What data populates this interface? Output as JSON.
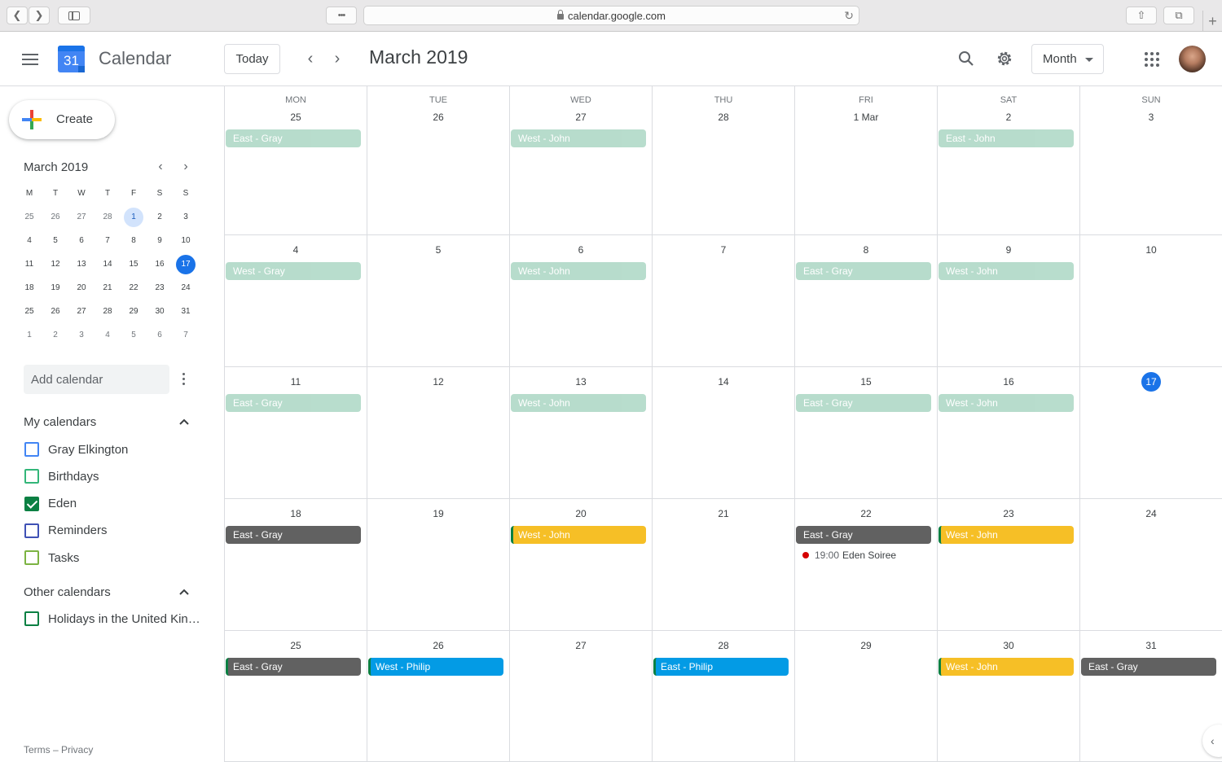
{
  "browser": {
    "url": "calendar.google.com",
    "more_label": "•••"
  },
  "header": {
    "app_title": "Calendar",
    "logo_day": "31",
    "today_label": "Today",
    "period": "March 2019",
    "view_label": "Month"
  },
  "sidebar": {
    "create_label": "Create",
    "mini_month": "March 2019",
    "weekday_heads": [
      "M",
      "T",
      "W",
      "T",
      "F",
      "S",
      "S"
    ],
    "weeks": [
      [
        "25",
        "26",
        "27",
        "28",
        "1",
        "2",
        "3"
      ],
      [
        "4",
        "5",
        "6",
        "7",
        "8",
        "9",
        "10"
      ],
      [
        "11",
        "12",
        "13",
        "14",
        "15",
        "16",
        "17"
      ],
      [
        "18",
        "19",
        "20",
        "21",
        "22",
        "23",
        "24"
      ],
      [
        "25",
        "26",
        "27",
        "28",
        "29",
        "30",
        "31"
      ],
      [
        "1",
        "2",
        "3",
        "4",
        "5",
        "6",
        "7"
      ]
    ],
    "add_calendar_placeholder": "Add calendar",
    "my_calendars_title": "My calendars",
    "my_calendars": [
      {
        "name": "Gray Elkington",
        "color": "#4285f4",
        "checked": false
      },
      {
        "name": "Birthdays",
        "color": "#33b679",
        "checked": false
      },
      {
        "name": "Eden",
        "color": "#0b8043",
        "checked": true
      },
      {
        "name": "Reminders",
        "color": "#3f51b5",
        "checked": false
      },
      {
        "name": "Tasks",
        "color": "#7cb342",
        "checked": false
      }
    ],
    "other_calendars_title": "Other calendars",
    "other_calendars": [
      {
        "name": "Holidays in the United Kin…",
        "color": "#0b8043",
        "checked": false
      }
    ],
    "footer": "Terms – Privacy"
  },
  "month": {
    "weekdays": [
      "MON",
      "TUE",
      "WED",
      "THU",
      "FRI",
      "SAT",
      "SUN"
    ],
    "weeks": [
      [
        {
          "label": "25",
          "events": [
            {
              "title": "East - Gray",
              "color": "#0b8043",
              "past": true
            }
          ]
        },
        {
          "label": "26",
          "events": []
        },
        {
          "label": "27",
          "events": [
            {
              "title": "West - John",
              "color": "#0b8043",
              "past": true
            }
          ]
        },
        {
          "label": "28",
          "events": []
        },
        {
          "label": "1 Mar",
          "events": []
        },
        {
          "label": "2",
          "events": [
            {
              "title": "East - John",
              "color": "#0b8043",
              "past": true
            }
          ]
        },
        {
          "label": "3",
          "events": []
        }
      ],
      [
        {
          "label": "4",
          "events": [
            {
              "title": "West - Gray",
              "color": "#0b8043",
              "past": true
            }
          ]
        },
        {
          "label": "5",
          "events": []
        },
        {
          "label": "6",
          "events": [
            {
              "title": "West - John",
              "color": "#0b8043",
              "past": true
            }
          ]
        },
        {
          "label": "7",
          "events": []
        },
        {
          "label": "8",
          "events": [
            {
              "title": "East - Gray",
              "color": "#0b8043",
              "past": true
            }
          ]
        },
        {
          "label": "9",
          "events": [
            {
              "title": "West - John",
              "color": "#0b8043",
              "past": true
            }
          ]
        },
        {
          "label": "10",
          "events": []
        }
      ],
      [
        {
          "label": "11",
          "events": [
            {
              "title": "East - Gray",
              "color": "#0b8043",
              "past": true
            }
          ]
        },
        {
          "label": "12",
          "events": []
        },
        {
          "label": "13",
          "events": [
            {
              "title": "West - John",
              "color": "#0b8043",
              "past": true
            }
          ]
        },
        {
          "label": "14",
          "events": []
        },
        {
          "label": "15",
          "events": [
            {
              "title": "East - Gray",
              "color": "#0b8043",
              "past": true
            }
          ]
        },
        {
          "label": "16",
          "events": [
            {
              "title": "West - John",
              "color": "#0b8043",
              "past": true
            }
          ]
        },
        {
          "label": "17",
          "today": true,
          "events": []
        }
      ],
      [
        {
          "label": "18",
          "events": [
            {
              "title": "East - Gray",
              "color": "#616161"
            }
          ]
        },
        {
          "label": "19",
          "events": []
        },
        {
          "label": "20",
          "events": [
            {
              "title": "West - John",
              "color": "#f6bf26",
              "bar": true
            }
          ]
        },
        {
          "label": "21",
          "events": []
        },
        {
          "label": "22",
          "events": [
            {
              "title": "East - Gray",
              "color": "#616161"
            },
            {
              "dot": true,
              "time": "19:00",
              "title": "Eden Soiree"
            }
          ]
        },
        {
          "label": "23",
          "events": [
            {
              "title": "West - John",
              "color": "#f6bf26",
              "bar": true
            }
          ]
        },
        {
          "label": "24",
          "events": []
        }
      ],
      [
        {
          "label": "25",
          "events": [
            {
              "title": "East - Gray",
              "color": "#616161",
              "bar": true
            }
          ]
        },
        {
          "label": "26",
          "events": [
            {
              "title": "West - Philip",
              "color": "#039be5",
              "bar": true
            }
          ]
        },
        {
          "label": "27",
          "events": []
        },
        {
          "label": "28",
          "events": [
            {
              "title": "East - Philip",
              "color": "#039be5",
              "bar": true
            }
          ]
        },
        {
          "label": "29",
          "events": []
        },
        {
          "label": "30",
          "events": [
            {
              "title": "West - John",
              "color": "#f6bf26",
              "bar": true
            }
          ]
        },
        {
          "label": "31",
          "events": [
            {
              "title": "East - Gray",
              "color": "#616161"
            }
          ]
        }
      ]
    ]
  },
  "colors": {
    "accent": "#1a73e8",
    "selected_day_bg": "#d2e3fc",
    "grid_line": "#dadce0"
  }
}
